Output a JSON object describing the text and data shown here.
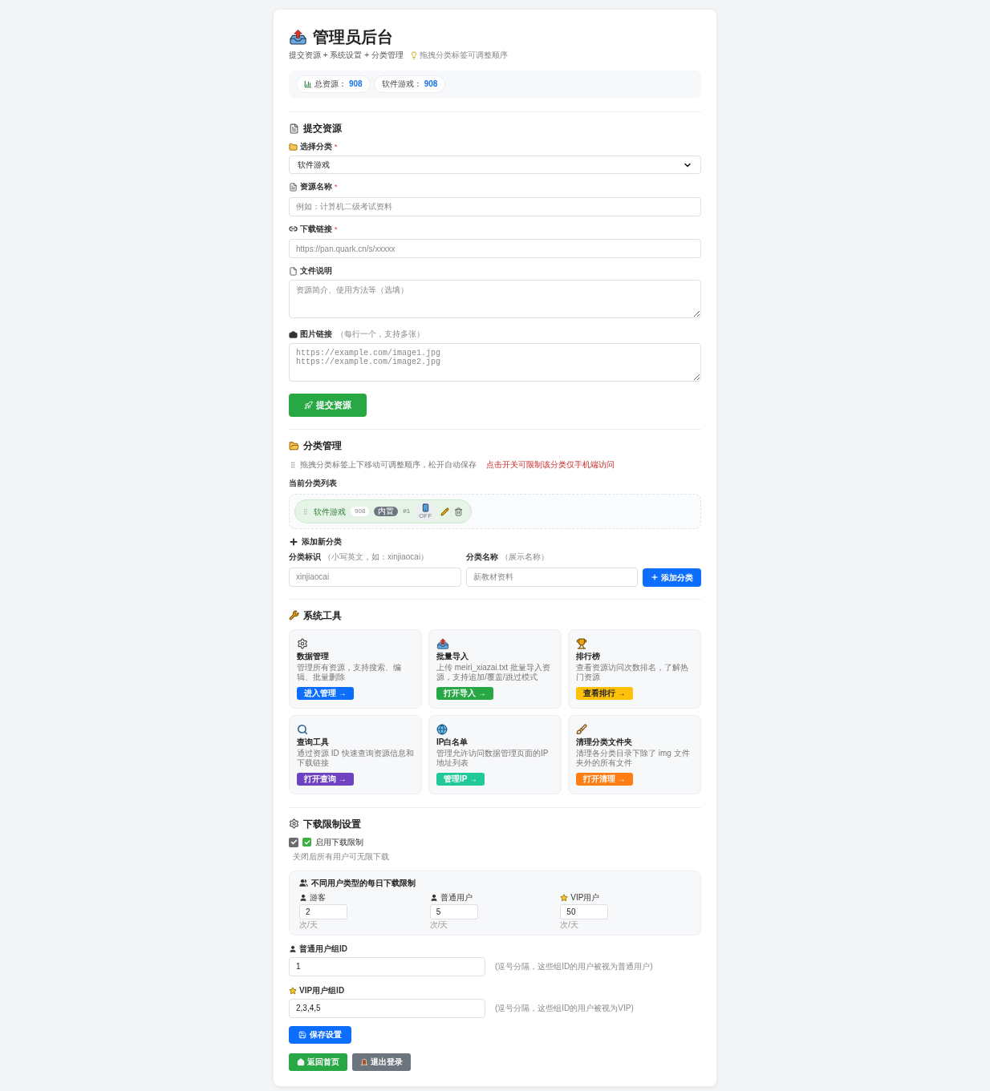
{
  "header": {
    "title": "管理员后台",
    "breadcrumb": "提交资源 + 系统设置 + 分类管理",
    "tip": "拖拽分类标签可调整顺序"
  },
  "stats": [
    {
      "kind": "total",
      "label": "总资源：",
      "value": "908"
    },
    {
      "kind": "category",
      "label": "软件游戏：",
      "value": "908"
    }
  ],
  "submit": {
    "title": "提交资源",
    "fields": [
      {
        "kind": "select",
        "label": "选择分类",
        "required_mark": "*",
        "value": "软件游戏"
      },
      {
        "kind": "input",
        "label": "资源名称",
        "required_mark": "*",
        "placeholder": "例如：计算机二级考试资料"
      },
      {
        "kind": "input",
        "label": "下载链接",
        "required_mark": "*",
        "placeholder": "https://pan.quark.cn/s/xxxxx"
      },
      {
        "kind": "textarea",
        "label": "文件说明",
        "placeholder": "资源简介、使用方法等（选填）"
      },
      {
        "kind": "code_textarea",
        "label": "图片链接",
        "hint": "（每行一个，支持多张）",
        "placeholder": "https://example.com/image1.jpg\nhttps://example.com/image2.jpg"
      }
    ],
    "button": "提交资源"
  },
  "categories_section": {
    "title": "分类管理",
    "hint": "拖拽分类标签上下移动可调整顺序，松开自动保存",
    "warning": "点击开关可限制该分类仅手机端访问",
    "list_title": "当前分类列表",
    "categories": [
      {
        "name": "软件游戏",
        "count": "908",
        "badge": "内置",
        "order": "#1",
        "mobile_only": false,
        "switch_label": "OFF"
      }
    ],
    "add": {
      "title": "添加新分类",
      "fields": [
        {
          "label": "分类标识",
          "hint": "（小写英文，如：xinjiaocai）",
          "placeholder": "xinjiaocai"
        },
        {
          "label": "分类名称",
          "hint": "（展示名称）",
          "placeholder": "新教材资料"
        }
      ],
      "button": "添加分类"
    }
  },
  "tools_section": {
    "title": "系统工具",
    "tools": [
      {
        "title": "数据管理",
        "description": "管理所有资源，支持搜索、编辑、批量删除",
        "button": "进入管理 →",
        "color": "#0d6efd"
      },
      {
        "title": "批量导入",
        "description": "上传 meiri_xiazai.txt 批量导入资源，支持追加/覆盖/跳过模式",
        "button": "打开导入 →",
        "color": "#28a745"
      },
      {
        "title": "排行榜",
        "description": "查看资源访问次数排名，了解热门资源",
        "button": "查看排行 →",
        "color": "#ffc107"
      },
      {
        "title": "查询工具",
        "description": "通过资源 ID 快速查询资源信息和下载链接",
        "button": "打开查询 →",
        "color": "#6f42c1"
      },
      {
        "title": "IP白名单",
        "description": "管理允许访问数据管理页面的IP地址列表",
        "button": "管理IP →",
        "color": "#20c997"
      },
      {
        "title": "清理分类文件夹",
        "description": "清理各分类目录下除了 img 文件夹外的所有文件",
        "button": "打开清理 →",
        "color": "#fd7e14"
      }
    ]
  },
  "download_limit": {
    "title": "下载限制设置",
    "enable": {
      "checked": true,
      "label": "启用下载限制"
    },
    "enable_note": "关闭后所有用户可无限下载",
    "limits": {
      "title": "不同用户类型的每日下载限制",
      "items": [
        {
          "label": "游客",
          "value": "2",
          "unit": "次/天"
        },
        {
          "label": "普通用户",
          "value": "5",
          "unit": "次/天"
        },
        {
          "label": "VIP用户",
          "value": "50",
          "unit": "次/天"
        }
      ]
    },
    "groups": [
      {
        "label": "普通用户组ID",
        "value": "1",
        "note": "(逗号分隔，这些组ID的用户被视为普通用户)"
      },
      {
        "label": "VIP用户组ID",
        "value": "2,3,4,5",
        "note": "(逗号分隔，这些组ID的用户被视为VIP)"
      }
    ],
    "save_button": "保存设置"
  },
  "footer_buttons": [
    {
      "kind": "home",
      "label": "返回首页"
    },
    {
      "kind": "logout",
      "label": "退出登录"
    }
  ]
}
